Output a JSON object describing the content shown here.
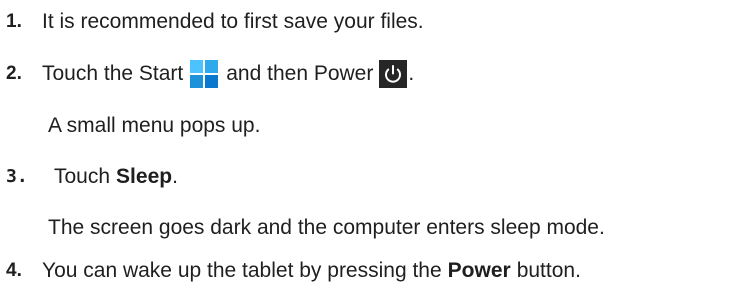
{
  "steps": [
    {
      "number": "1.",
      "text": "It is recommended to first save your files."
    },
    {
      "number": "2.",
      "text_before": "Touch the Start",
      "text_middle": "and then Power",
      "text_after": "."
    },
    {
      "text": "A small menu pops up."
    },
    {
      "number": "3.",
      "text_before": "Touch",
      "bold": "Sleep",
      "text_after": "."
    },
    {
      "text": "The screen goes dark and the computer enters sleep mode."
    },
    {
      "number": "4.",
      "text_before": "You can wake up the tablet by pressing the",
      "bold": "Power",
      "text_after": "button."
    }
  ],
  "icons": {
    "start": "windows-start-icon",
    "power": "power-icon"
  },
  "colors": {
    "start_icon": "#1c92db",
    "power_icon_bg": "#262626"
  }
}
